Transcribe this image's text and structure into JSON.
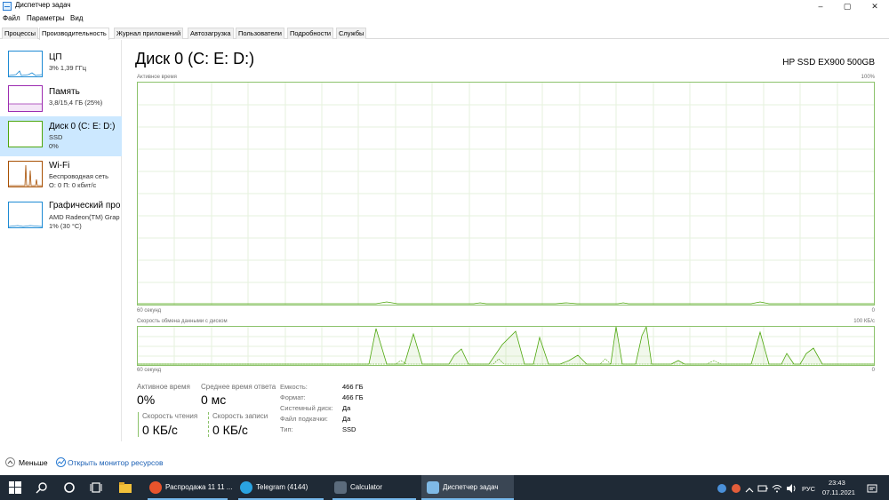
{
  "window": {
    "title": "Диспетчер задач",
    "minimize": "–",
    "maximize": "▢",
    "close": "✕"
  },
  "menu": [
    "Файл",
    "Параметры",
    "Вид"
  ],
  "tabs": [
    "Процессы",
    "Производительность",
    "Журнал приложений",
    "Автозагрузка",
    "Пользователи",
    "Подробности",
    "Службы"
  ],
  "active_tab": "Производительность",
  "sidebar": {
    "items": [
      {
        "name": "ЦП",
        "line1": "3% 1,39 ГГц",
        "line2": "",
        "graph_color": "#1c8ad4"
      },
      {
        "name": "Память",
        "line1": "3,8/15,4 ГБ (25%)",
        "line2": "",
        "graph_color": "#9c2bb0"
      },
      {
        "name": "Диск 0 (C: E: D:)",
        "line1": "SSD",
        "line2": "0%",
        "graph_color": "#4da60c"
      },
      {
        "name": "Wi-Fi",
        "line1": "Беспроводная сеть",
        "line2": "О: 0 П: 0 кбит/с",
        "graph_color": "#a74f01"
      },
      {
        "name": "Графический про",
        "line1": "AMD Radeon(TM) Grap",
        "line2": "1% (30 °C)",
        "graph_color": "#1c8ad4"
      }
    ]
  },
  "main": {
    "title": "Диск 0 (C: E: D:)",
    "device": "HP SSD EX900 500GB",
    "graph1": {
      "label": "Активное время",
      "max": "100%",
      "time": "60 секунд",
      "min": "0"
    },
    "graph2": {
      "label": "Скорость обмена данными с диском",
      "max": "100 КБ/с",
      "time": "60 секунд",
      "min": "0"
    },
    "stats": {
      "active_time_label": "Активное время",
      "active_time_value": "0%",
      "avg_response_label": "Среднее время ответа",
      "avg_response_value": "0 мс",
      "read_label": "Скорость чтения",
      "read_value": "0 КБ/с",
      "write_label": "Скорость записи",
      "write_value": "0 КБ/с"
    },
    "info": [
      {
        "label": "Емкость:",
        "value": "466 ГБ"
      },
      {
        "label": "Формат:",
        "value": "466 ГБ"
      },
      {
        "label": "Системный диск:",
        "value": "Да"
      },
      {
        "label": "Файл подкачки:",
        "value": "Да"
      },
      {
        "label": "Тип:",
        "value": "SSD"
      }
    ]
  },
  "footer": {
    "less": "Меньше",
    "monitor": "Открыть монитор ресурсов"
  },
  "taskbar": {
    "apps": [
      {
        "label": "Распродажа 11 11 ...",
        "icon_color": "#e8542c"
      },
      {
        "label": "Telegram (4144)",
        "icon_color": "#2aa3e0"
      },
      {
        "label": "Calculator",
        "icon_color": "#5b6b7c"
      },
      {
        "label": "Диспетчер задач",
        "icon_color": "#7fb9e6"
      }
    ],
    "lang": "РУС",
    "time": "23:43",
    "date": "07.11.2021"
  }
}
